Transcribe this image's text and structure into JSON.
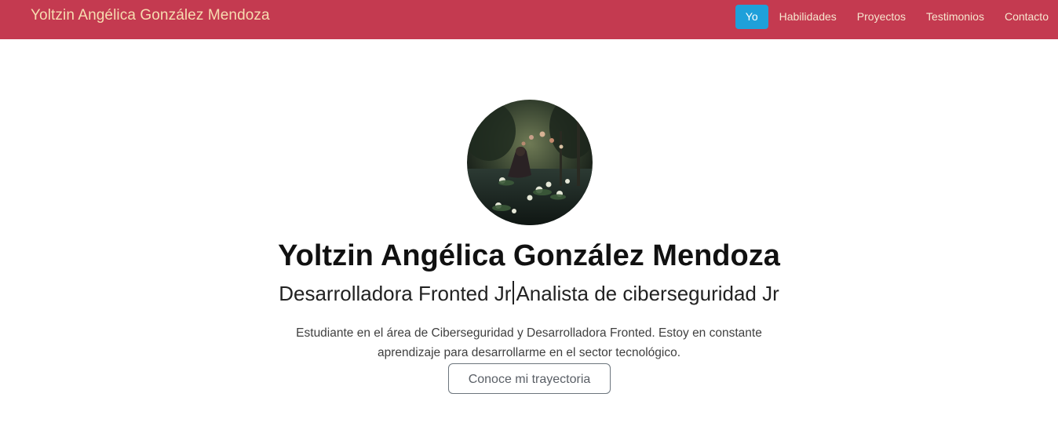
{
  "navbar": {
    "brand": "Yoltzin Angélica González Mendoza",
    "links": [
      {
        "label": "Yo",
        "active": true
      },
      {
        "label": "Habilidades",
        "active": false
      },
      {
        "label": "Proyectos",
        "active": false
      },
      {
        "label": "Testimonios",
        "active": false
      },
      {
        "label": "Contacto",
        "active": false
      }
    ]
  },
  "colors": {
    "navbar_bg": "#c43a50",
    "brand_text": "#f7dcb0",
    "active_link_bg": "#1ea0da"
  },
  "hero": {
    "name": "Yoltzin Angélica González Mendoza",
    "subtitle_left": "Desarrolladora Fronted Jr",
    "subtitle_right": "Analista de ciberseguridad Jr",
    "description": "Estudiante en el área de Ciberseguridad y Desarrolladora Fronted. Estoy en constante aprendizaje para desarrollarme en el sector tecnológico.",
    "cta_label": "Conoce mi trayectoria"
  }
}
